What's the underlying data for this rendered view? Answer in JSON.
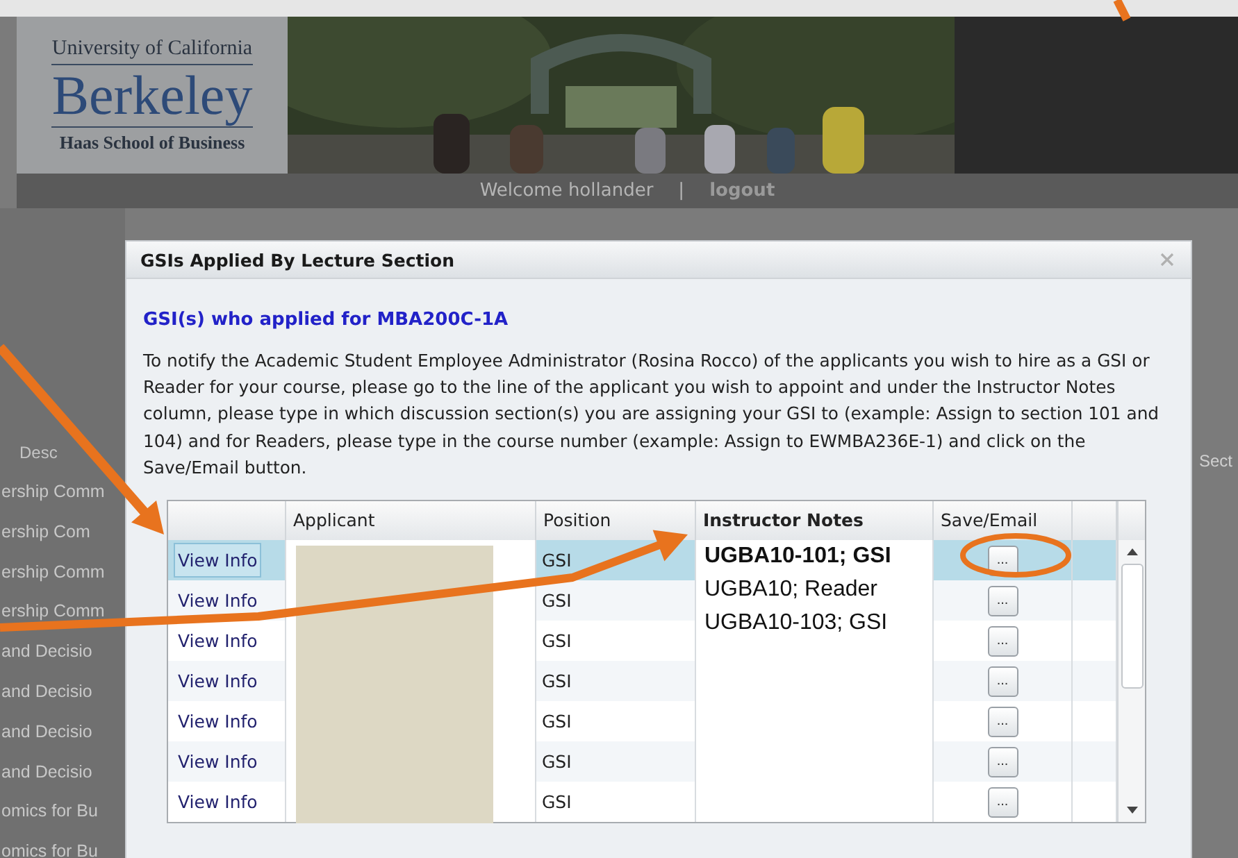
{
  "header": {
    "logo": {
      "line1": "University of California",
      "line2": "Berkeley",
      "line3": "Haas School of Business"
    },
    "nav": {
      "welcome": "Welcome hollander",
      "separator": "|",
      "logout": "logout"
    }
  },
  "background_table": {
    "column_1": "Desc",
    "column_2": "Sect",
    "rows": [
      "ership Comm",
      "ership Com",
      "ership Comm",
      "ership Comm",
      "and Decisio",
      "and Decisio",
      "and Decisio",
      "and Decisio",
      "omics for Bu",
      "omics for Bu"
    ]
  },
  "dialog": {
    "title": "GSIs Applied By Lecture Section",
    "heading": "GSI(s) who applied for MBA200C-1A",
    "instructions": "To notify the Academic Student Employee Administrator (Rosina Rocco) of the applicants you wish to hire as a GSI or Reader for your course, please go to the line of the applicant you wish to appoint and under the Instructor Notes column, please type in which discussion section(s) you are assigning your GSI to (example: Assign to section 101 and 104) and for Readers, please type in the course number (example: Assign to EWMBA236E-1) and click on the Save/Email button.",
    "table": {
      "columns": {
        "applicant": "Applicant",
        "position": "Position",
        "notes": "Instructor Notes",
        "save": "Save/Email"
      },
      "rows": [
        {
          "link": "View Info",
          "position": "GSI",
          "button": "...",
          "selected": true
        },
        {
          "link": "View Info",
          "position": "GSI",
          "button": "...",
          "selected": false
        },
        {
          "link": "View Info",
          "position": "GSI",
          "button": "...",
          "selected": false
        },
        {
          "link": "View Info",
          "position": "GSI",
          "button": "...",
          "selected": false
        },
        {
          "link": "View Info",
          "position": "GSI",
          "button": "...",
          "selected": false
        },
        {
          "link": "View Info",
          "position": "GSI",
          "button": "...",
          "selected": false
        },
        {
          "link": "View Info",
          "position": "GSI",
          "button": "...",
          "selected": false
        }
      ],
      "notes_box": {
        "lines": [
          {
            "text": "UGBA10-101; GSI",
            "bold": true
          },
          {
            "text": "UGBA10; Reader",
            "bold": false
          },
          {
            "text": "UGBA10-103; GSI",
            "bold": false
          }
        ]
      }
    }
  }
}
